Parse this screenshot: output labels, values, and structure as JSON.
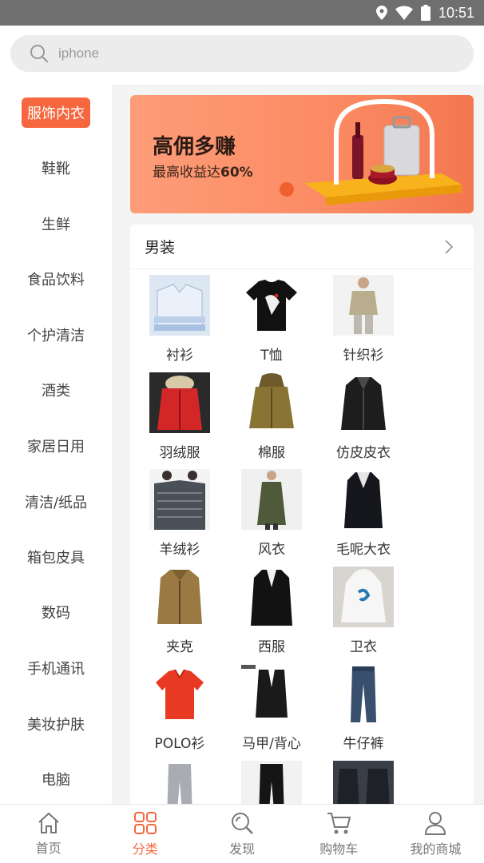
{
  "status": {
    "time": "10:51"
  },
  "search": {
    "placeholder": "iphone"
  },
  "sidebar": {
    "active_color": "#f6673f",
    "items": [
      {
        "label": "服饰内衣",
        "active": true
      },
      {
        "label": "鞋靴"
      },
      {
        "label": "生鲜"
      },
      {
        "label": "食品饮料"
      },
      {
        "label": "个护清洁"
      },
      {
        "label": "酒类"
      },
      {
        "label": "家居日用"
      },
      {
        "label": "清洁/纸品"
      },
      {
        "label": "箱包皮具"
      },
      {
        "label": "数码"
      },
      {
        "label": "手机通讯"
      },
      {
        "label": "美妆护肤"
      },
      {
        "label": "电脑"
      }
    ]
  },
  "banner": {
    "title": "高佣多赚",
    "subtitle_prefix": "最高收益达",
    "subtitle_value": "60%"
  },
  "section": {
    "title": "男装",
    "items": [
      {
        "label": "衬衫",
        "icon": "shirt"
      },
      {
        "label": "T恤",
        "icon": "tshirt"
      },
      {
        "label": "针织衫",
        "icon": "knit"
      },
      {
        "label": "羽绒服",
        "icon": "down-jacket"
      },
      {
        "label": "棉服",
        "icon": "cotton-coat"
      },
      {
        "label": "仿皮皮衣",
        "icon": "leather-jacket"
      },
      {
        "label": "羊绒衫",
        "icon": "cashmere"
      },
      {
        "label": "风衣",
        "icon": "trench"
      },
      {
        "label": "毛呢大衣",
        "icon": "wool-coat"
      },
      {
        "label": "夹克",
        "icon": "jacket"
      },
      {
        "label": "西服",
        "icon": "suit"
      },
      {
        "label": "卫衣",
        "icon": "hoodie"
      },
      {
        "label": "POLO衫",
        "icon": "polo"
      },
      {
        "label": "马甲/背心",
        "icon": "vest"
      },
      {
        "label": "牛仔裤",
        "icon": "jeans"
      },
      {
        "label": "",
        "icon": "pants-grey"
      },
      {
        "label": "",
        "icon": "pants-black"
      },
      {
        "label": "",
        "icon": "suit-set"
      }
    ]
  },
  "tabbar": {
    "items": [
      {
        "label": "首页",
        "icon": "home-icon"
      },
      {
        "label": "分类",
        "icon": "grid-icon",
        "active": true
      },
      {
        "label": "发现",
        "icon": "discover-icon"
      },
      {
        "label": "购物车",
        "icon": "cart-icon"
      },
      {
        "label": "我的商城",
        "icon": "user-icon"
      }
    ]
  }
}
